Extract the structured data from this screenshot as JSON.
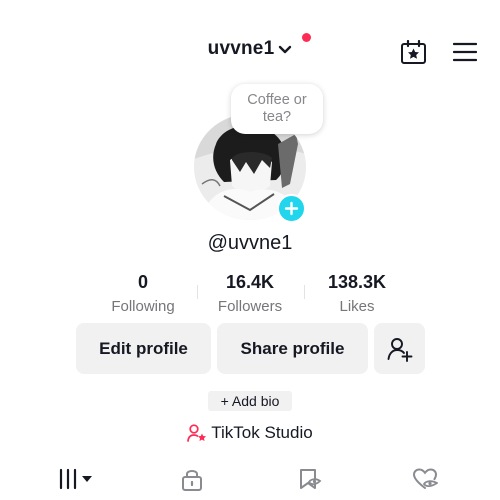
{
  "header": {
    "username": "uvvne1",
    "icons": {
      "calendar": "calendar-star-icon",
      "menu": "hamburger-menu-icon",
      "chevron": "chevron-down-icon"
    },
    "notification_color": "#fe2c55"
  },
  "profile": {
    "note": "Coffee or tea?",
    "handle": "@uvvne1",
    "add_badge_color": "#20d5ec"
  },
  "stats": [
    {
      "value": "0",
      "label": "Following"
    },
    {
      "value": "16.4K",
      "label": "Followers"
    },
    {
      "value": "138.3K",
      "label": "Likes"
    }
  ],
  "actions": {
    "edit": "Edit profile",
    "share": "Share profile",
    "add_friend_icon": "add-friend-icon"
  },
  "bio_button": "+ Add bio",
  "studio_link": "TikTok Studio",
  "tabs": [
    {
      "icon": "grid-videos-icon",
      "active": true
    },
    {
      "icon": "lock-icon",
      "active": false
    },
    {
      "icon": "favorites-icon",
      "active": false
    },
    {
      "icon": "liked-icon",
      "active": false
    }
  ]
}
